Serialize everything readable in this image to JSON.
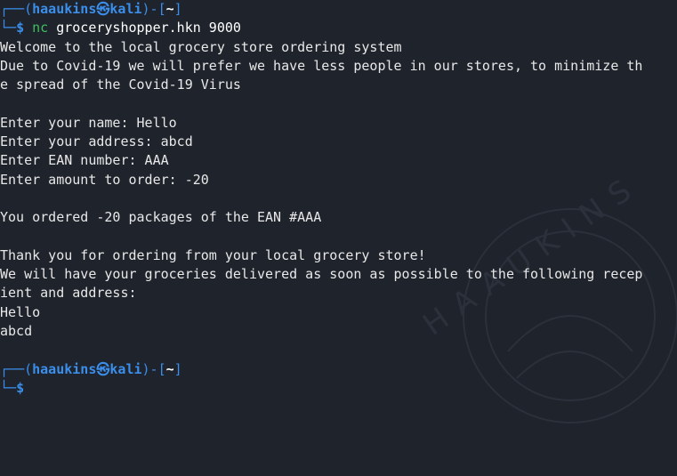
{
  "prompt_top": {
    "corner": "┌──",
    "open_paren": "(",
    "user": "haaukins",
    "at_symbol": "㉿",
    "host": "kali",
    "close_paren": ")",
    "dash": "-",
    "open_bracket": "[",
    "cwd": "~",
    "close_bracket": "]"
  },
  "prompt_cmd": {
    "corner": "└─",
    "dollar": "$",
    "command": "nc",
    "args": " groceryshopper.hkn 9000"
  },
  "output": [
    "Welcome to the local grocery store ordering system",
    "Due to Covid-19 we will prefer we have less people in our stores, to minimize th",
    "e spread of the Covid-19 Virus",
    "",
    "Enter your name: Hello",
    "Enter your address: abcd",
    "Enter EAN number: AAA",
    "Enter amount to order: -20",
    "",
    "You ordered -20 packages of the EAN #AAA",
    "",
    "Thank you for ordering from your local grocery store!",
    "We will have your groceries delivered as soon as possible to the following recep",
    "ient and address:",
    "Hello",
    "abcd",
    ""
  ],
  "prompt_bottom": {
    "corner": "┌──",
    "open_paren": "(",
    "user": "haaukins",
    "at_symbol": "㉿",
    "host": "kali",
    "close_paren": ")",
    "dash": "-",
    "open_bracket": "[",
    "cwd": "~",
    "close_bracket": "]"
  },
  "prompt_last": {
    "corner": "└─",
    "dollar": "$"
  },
  "watermark": {
    "text": "HAAUKINS",
    "icon": "haaukins-logo-icon"
  },
  "colors": {
    "background": "#1f232c",
    "prompt_blue": "#3b8eea",
    "text": "#e8e8e8",
    "command_green": "#3fbf5f"
  }
}
